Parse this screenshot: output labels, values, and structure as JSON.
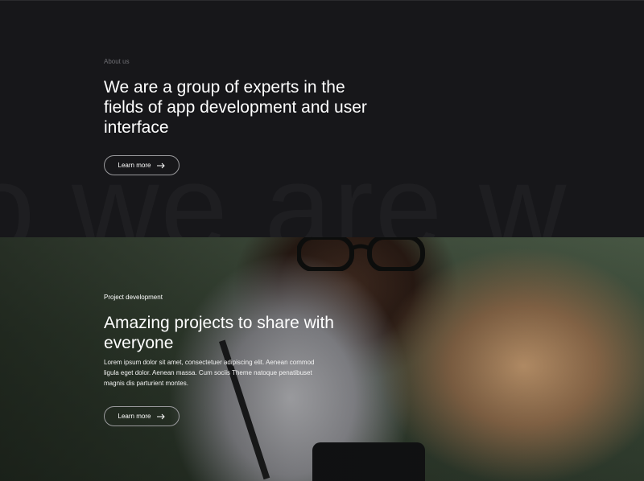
{
  "about": {
    "eyebrow": "About us",
    "headline": "We are a group of experts in the fields of app development and user interface",
    "button_label": "Learn more",
    "background_word": "o we are  w"
  },
  "project": {
    "eyebrow": "Project development",
    "headline": "Amazing projects to share with everyone",
    "body": "Lorem ipsum dolor sit amet, consectetuer adipiscing elit. Aenean commod ligula eget dolor. Aenean massa. Cum sociis Theme natoque penatibuset magnis dis parturient montes.",
    "button_label": "Learn more"
  },
  "colors": {
    "background": "#17171a",
    "text": "#ffffff",
    "muted": "#6f6f74",
    "button_border": "#9a9a9d"
  },
  "icons": {
    "button_arrow": "arrow-right-icon"
  }
}
